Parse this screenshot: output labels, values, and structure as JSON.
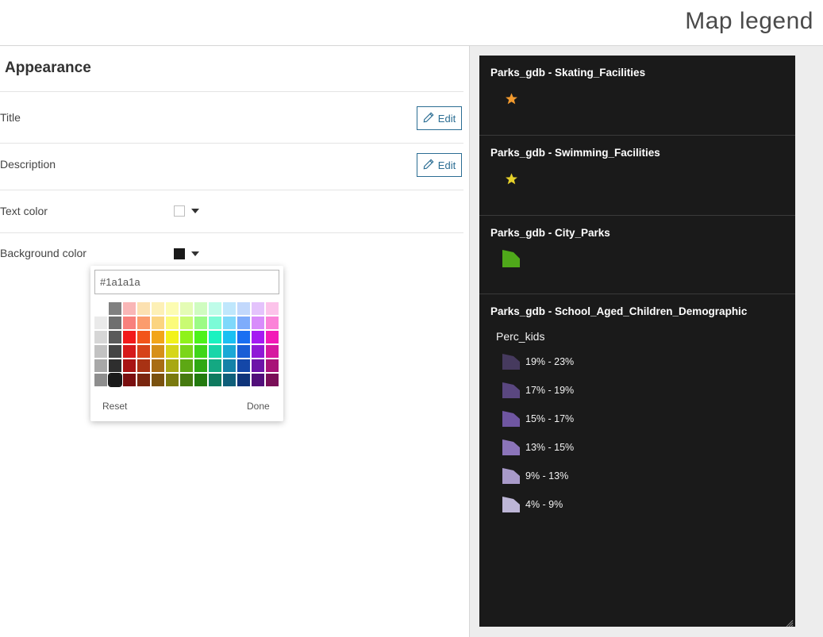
{
  "header": {
    "title": "Map legend"
  },
  "appearance": {
    "title": "Appearance",
    "rows": {
      "title_label": "Title",
      "description_label": "Description",
      "edit_label": "Edit",
      "text_color_label": "Text color",
      "background_color_label": "Background color"
    },
    "text_color": "#ffffff",
    "background_color": "#1a1a1a"
  },
  "color_picker": {
    "hex_value": "#1a1a1a",
    "reset_label": "Reset",
    "done_label": "Done",
    "selected": "#1a1a1a",
    "swatch_rows": [
      [
        "",
        "#808080",
        "#f9b6b6",
        "#fce1b1",
        "#fdf0b6",
        "#fcfcb2",
        "#e4fcb5",
        "#cffcc0",
        "#bffce9",
        "#bfe7fc",
        "#c2d8fc",
        "#e4c3fc",
        "#fcc3ea"
      ],
      [
        "#eaeaea",
        "#6f6f6f",
        "#f8807c",
        "#fb9c6d",
        "#fbd480",
        "#fbfb7a",
        "#c9fb72",
        "#9cfb86",
        "#7cfbd7",
        "#7ed8fb",
        "#7eacfb",
        "#d88cfb",
        "#fb83d8"
      ],
      [
        "#d6d6d6",
        "#5a5a5a",
        "#f21a1a",
        "#f2541a",
        "#f2a51a",
        "#f2f21a",
        "#8ff21a",
        "#4df21a",
        "#1af2c0",
        "#1ac0f2",
        "#1a6ff2",
        "#a51af2",
        "#f21ab7"
      ],
      [
        "#c2c2c2",
        "#444444",
        "#d61a1a",
        "#d6431a",
        "#d6901a",
        "#d6d61a",
        "#7bd61a",
        "#3fd61a",
        "#1ad6a9",
        "#1aa9d6",
        "#1a5ed6",
        "#901ad6",
        "#d61aa0"
      ],
      [
        "#a8a8a8",
        "#2e2e2e",
        "#a81414",
        "#a83214",
        "#a86d14",
        "#a8a814",
        "#5da814",
        "#2fa814",
        "#14a882",
        "#1482a8",
        "#1447a8",
        "#6d14a8",
        "#a81478"
      ],
      [
        "#8e8e8e",
        "#1a1a1a",
        "#7a0f0f",
        "#7a260f",
        "#7a520f",
        "#7a7a0f",
        "#457a0f",
        "#237a0f",
        "#0f7a5f",
        "#0f5f7a",
        "#0f347a",
        "#520f7a",
        "#7a0f58"
      ]
    ]
  },
  "legend": {
    "layers": [
      {
        "title": "Parks_gdb - Skating_Facilities",
        "symbol": "star-icon",
        "color": "#f29a2e"
      },
      {
        "title": "Parks_gdb - Swimming_Facilities",
        "symbol": "star-icon",
        "color": "#e6d12a"
      },
      {
        "title": "Parks_gdb - City_Parks",
        "symbol": "polygon-icon",
        "color": "#4fa81a"
      },
      {
        "title": "Parks_gdb - School_Aged_Children_Demographic",
        "field": "Perc_kids",
        "classes": [
          {
            "label": "19% - 23%",
            "color": "#463a5e"
          },
          {
            "label": "17% - 19%",
            "color": "#5a4780"
          },
          {
            "label": "15% - 17%",
            "color": "#6f56a1"
          },
          {
            "label": "13% - 15%",
            "color": "#8b74b9"
          },
          {
            "label": "9% - 13%",
            "color": "#a89ac9"
          },
          {
            "label": "4% - 9%",
            "color": "#bdb6d6"
          }
        ]
      }
    ]
  }
}
